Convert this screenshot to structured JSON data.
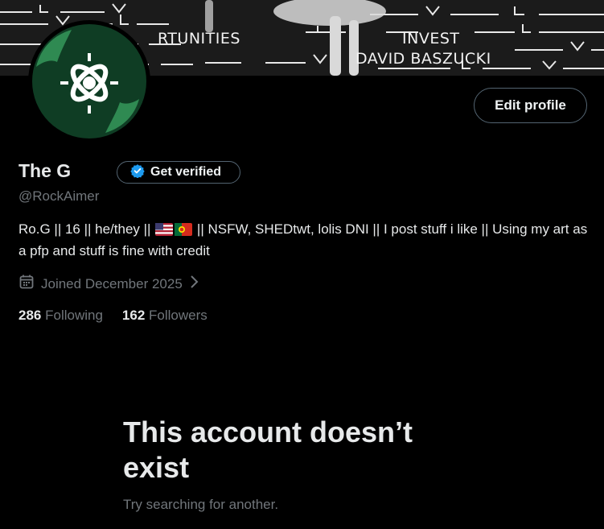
{
  "banner": {
    "line1_left": "RTUNITIES",
    "line1_right": "INVEST",
    "line2": "DAVID BASZUCKI"
  },
  "profile": {
    "display_name": "The G",
    "verify_label": "Get verified",
    "handle": "@RockAimer",
    "bio_before_flags": "Ro.G || 16 || he/they || ",
    "bio_after_flags": " || NSFW, SHEDtwt, lolis DNI || I post stuff i like || Using my art as a pfp and stuff is fine with credit",
    "joined": "Joined December 2025",
    "following_count": "286",
    "following_label": "Following",
    "followers_count": "162",
    "followers_label": "Followers",
    "edit_label": "Edit profile"
  },
  "empty_state": {
    "title": "This account doesn’t exist",
    "subtitle": "Try searching for another."
  },
  "colors": {
    "background": "#000000",
    "primary_text": "#e7e9ea",
    "secondary_text": "#71767b",
    "verified_blue": "#1d9bf0",
    "avatar_green": "#0f3d24"
  },
  "icons": [
    "verified-badge-icon",
    "calendar-icon",
    "chevron-right-icon",
    "us-flag-icon",
    "portugal-flag-icon"
  ]
}
